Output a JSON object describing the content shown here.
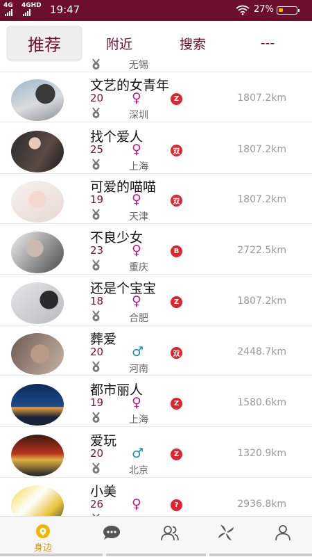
{
  "status_bar": {
    "signal_1": "4G",
    "signal_2": "4GHD",
    "time": "19:47",
    "battery": "27%",
    "battery_level": 0.27
  },
  "tabs": [
    {
      "label": "推荐",
      "active": true
    },
    {
      "label": "附近",
      "active": false
    },
    {
      "label": "搜索",
      "active": false
    },
    {
      "label": "---",
      "active": false
    }
  ],
  "partial_row": {
    "city": "无锡"
  },
  "users": [
    {
      "name": "文艺的女青年",
      "age": "20",
      "gender": "♀",
      "badge": "Z",
      "city": "深圳",
      "distance": "1807.2km"
    },
    {
      "name": "找个爱人",
      "age": "25",
      "gender": "♀",
      "badge": "双",
      "city": "上海",
      "distance": "1807.2km"
    },
    {
      "name": "可爱的喵喵",
      "age": "19",
      "gender": "♀",
      "badge": "双",
      "city": "天津",
      "distance": "1807.2km"
    },
    {
      "name": "不良少女",
      "age": "23",
      "gender": "♀",
      "badge": "B",
      "city": "重庆",
      "distance": "2722.5km"
    },
    {
      "name": "还是个宝宝",
      "age": "18",
      "gender": "♀",
      "badge": "Z",
      "city": "合肥",
      "distance": "1807.2km"
    },
    {
      "name": "葬爱",
      "age": "20",
      "gender": "♂",
      "badge": "双",
      "city": "河南",
      "distance": "2448.7km"
    },
    {
      "name": "都市丽人",
      "age": "19",
      "gender": "♀",
      "badge": "Z",
      "city": "上海",
      "distance": "1580.6km"
    },
    {
      "name": "爱玩",
      "age": "20",
      "gender": "♂",
      "badge": "Z",
      "city": "北京",
      "distance": "1320.9km"
    },
    {
      "name": "小美",
      "age": "26",
      "gender": "♀",
      "badge": "?",
      "city": "",
      "distance": "2936.8km"
    }
  ],
  "bottom_nav": [
    {
      "icon": "location-pin-icon",
      "label": "身边",
      "active": true
    },
    {
      "icon": "chat-bubble-icon",
      "label": ""
    },
    {
      "icon": "people-icon",
      "label": ""
    },
    {
      "icon": "pinwheel-icon",
      "label": ""
    },
    {
      "icon": "profile-icon",
      "label": ""
    }
  ],
  "colors": {
    "status_bar": "#6b0f2c",
    "tab_text": "#6b0f2c",
    "female": "#c2188c",
    "male": "#1b8fb0",
    "badge": "#e0242f",
    "nav_active": "#f2b500"
  }
}
